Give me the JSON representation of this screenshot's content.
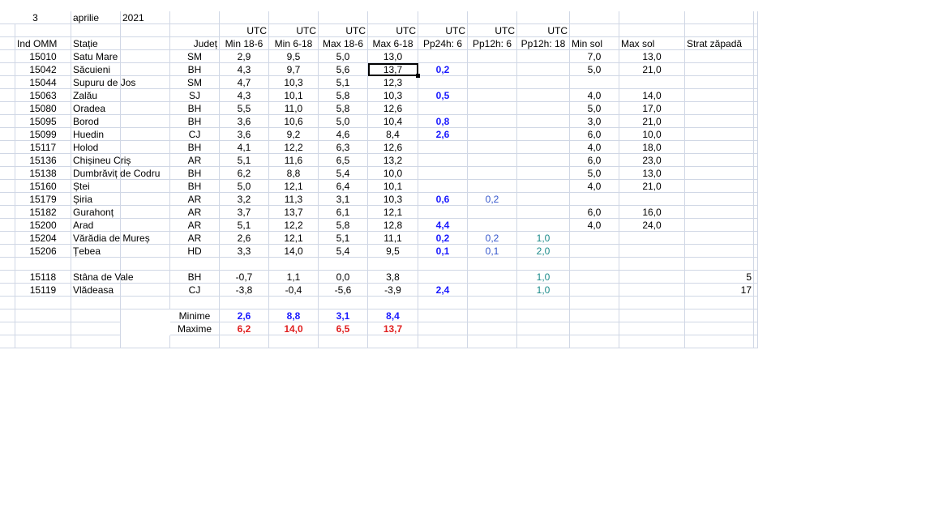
{
  "date": {
    "day": "3",
    "month": "aprilie",
    "year": "2021"
  },
  "utc_row": [
    "",
    "",
    "",
    "",
    "UTC",
    "UTC",
    "UTC",
    "UTC",
    "UTC",
    "UTC",
    "UTC",
    "",
    "",
    ""
  ],
  "headers": [
    "Ind OMM",
    "Stație",
    "Județ",
    "Min 18-6",
    "Min 6-18",
    "Max 18-6",
    "Max 6-18",
    "Pp24h: 6",
    "Pp12h: 6",
    "Pp12h: 18",
    "Min sol",
    "Max sol",
    "Strat zăpadă"
  ],
  "stations": [
    [
      "15010",
      "Satu Mare",
      "SM",
      "2,9",
      "9,5",
      "5,0",
      "13,0",
      "",
      "",
      "",
      "7,0",
      "13,0",
      ""
    ],
    [
      "15042",
      "Săcuieni",
      "BH",
      "4,3",
      "9,7",
      "5,6",
      "13,7",
      "0,2",
      "",
      "",
      "5,0",
      "21,0",
      ""
    ],
    [
      "15044",
      "Supuru de Jos",
      "SM",
      "4,7",
      "10,3",
      "5,1",
      "12,3",
      "",
      "",
      "",
      "",
      "",
      ""
    ],
    [
      "15063",
      "Zalău",
      "SJ",
      "4,3",
      "10,1",
      "5,8",
      "10,3",
      "0,5",
      "",
      "",
      "4,0",
      "14,0",
      ""
    ],
    [
      "15080",
      "Oradea",
      "BH",
      "5,5",
      "11,0",
      "5,8",
      "12,6",
      "",
      "",
      "",
      "5,0",
      "17,0",
      ""
    ],
    [
      "15095",
      "Borod",
      "BH",
      "3,6",
      "10,6",
      "5,0",
      "10,4",
      "0,8",
      "",
      "",
      "3,0",
      "21,0",
      ""
    ],
    [
      "15099",
      "Huedin",
      "CJ",
      "3,6",
      "9,2",
      "4,6",
      "8,4",
      "2,6",
      "",
      "",
      "6,0",
      "10,0",
      ""
    ],
    [
      "15117",
      "Holod",
      "BH",
      "4,1",
      "12,2",
      "6,3",
      "12,6",
      "",
      "",
      "",
      "4,0",
      "18,0",
      ""
    ],
    [
      "15136",
      "Chișineu   Criș",
      "AR",
      "5,1",
      "11,6",
      "6,5",
      "13,2",
      "",
      "",
      "",
      "6,0",
      "23,0",
      ""
    ],
    [
      "15138",
      "Dumbrăviț  de Codru",
      "BH",
      "6,2",
      "8,8",
      "5,4",
      "10,0",
      "",
      "",
      "",
      "5,0",
      "13,0",
      ""
    ],
    [
      "15160",
      "Ștei",
      "BH",
      "5,0",
      "12,1",
      "6,4",
      "10,1",
      "",
      "",
      "",
      "4,0",
      "21,0",
      ""
    ],
    [
      "15179",
      "Șiria",
      "AR",
      "3,2",
      "11,3",
      "3,1",
      "10,3",
      "0,6",
      "0,2",
      "",
      "",
      "",
      ""
    ],
    [
      "15182",
      "Gurahonț",
      "AR",
      "3,7",
      "13,7",
      "6,1",
      "12,1",
      "",
      "",
      "",
      "6,0",
      "16,0",
      ""
    ],
    [
      "15200",
      "Arad",
      "AR",
      "5,1",
      "12,2",
      "5,8",
      "12,8",
      "4,4",
      "",
      "",
      "4,0",
      "24,0",
      ""
    ],
    [
      "15204",
      "Vărădia de Mureș",
      "AR",
      "2,6",
      "12,1",
      "5,1",
      "11,1",
      "0,2",
      "0,2",
      "1,0",
      "",
      "",
      ""
    ],
    [
      "15206",
      "Țebea",
      "HD",
      "3,3",
      "14,0",
      "5,4",
      "9,5",
      "0,1",
      "0,1",
      "2,0",
      "",
      "",
      ""
    ]
  ],
  "mountain": [
    [
      "15118",
      "Stâna de Vale",
      "BH",
      "-0,7",
      "1,1",
      "0,0",
      "3,8",
      "",
      "",
      "1,0",
      "",
      "",
      "5"
    ],
    [
      "15119",
      "Vlădeasa",
      "CJ",
      "-3,8",
      "-0,4",
      "-5,6",
      "-3,9",
      "2,4",
      "",
      "1,0",
      "",
      "",
      "17"
    ]
  ],
  "summary": {
    "minime": {
      "label": "Minime",
      "values": [
        "2,6",
        "8,8",
        "3,1",
        "8,4"
      ]
    },
    "maxime": {
      "label": "Maxime",
      "values": [
        "6,2",
        "14,0",
        "6,5",
        "13,7"
      ]
    }
  },
  "colors": {
    "blue": "#1a1aff",
    "light_blue": "#3355cc",
    "teal": "#1a8a8a",
    "red": "#e02020",
    "grid": "#d0d7e5"
  },
  "selected_cell": {
    "row": 1,
    "col": 6
  }
}
